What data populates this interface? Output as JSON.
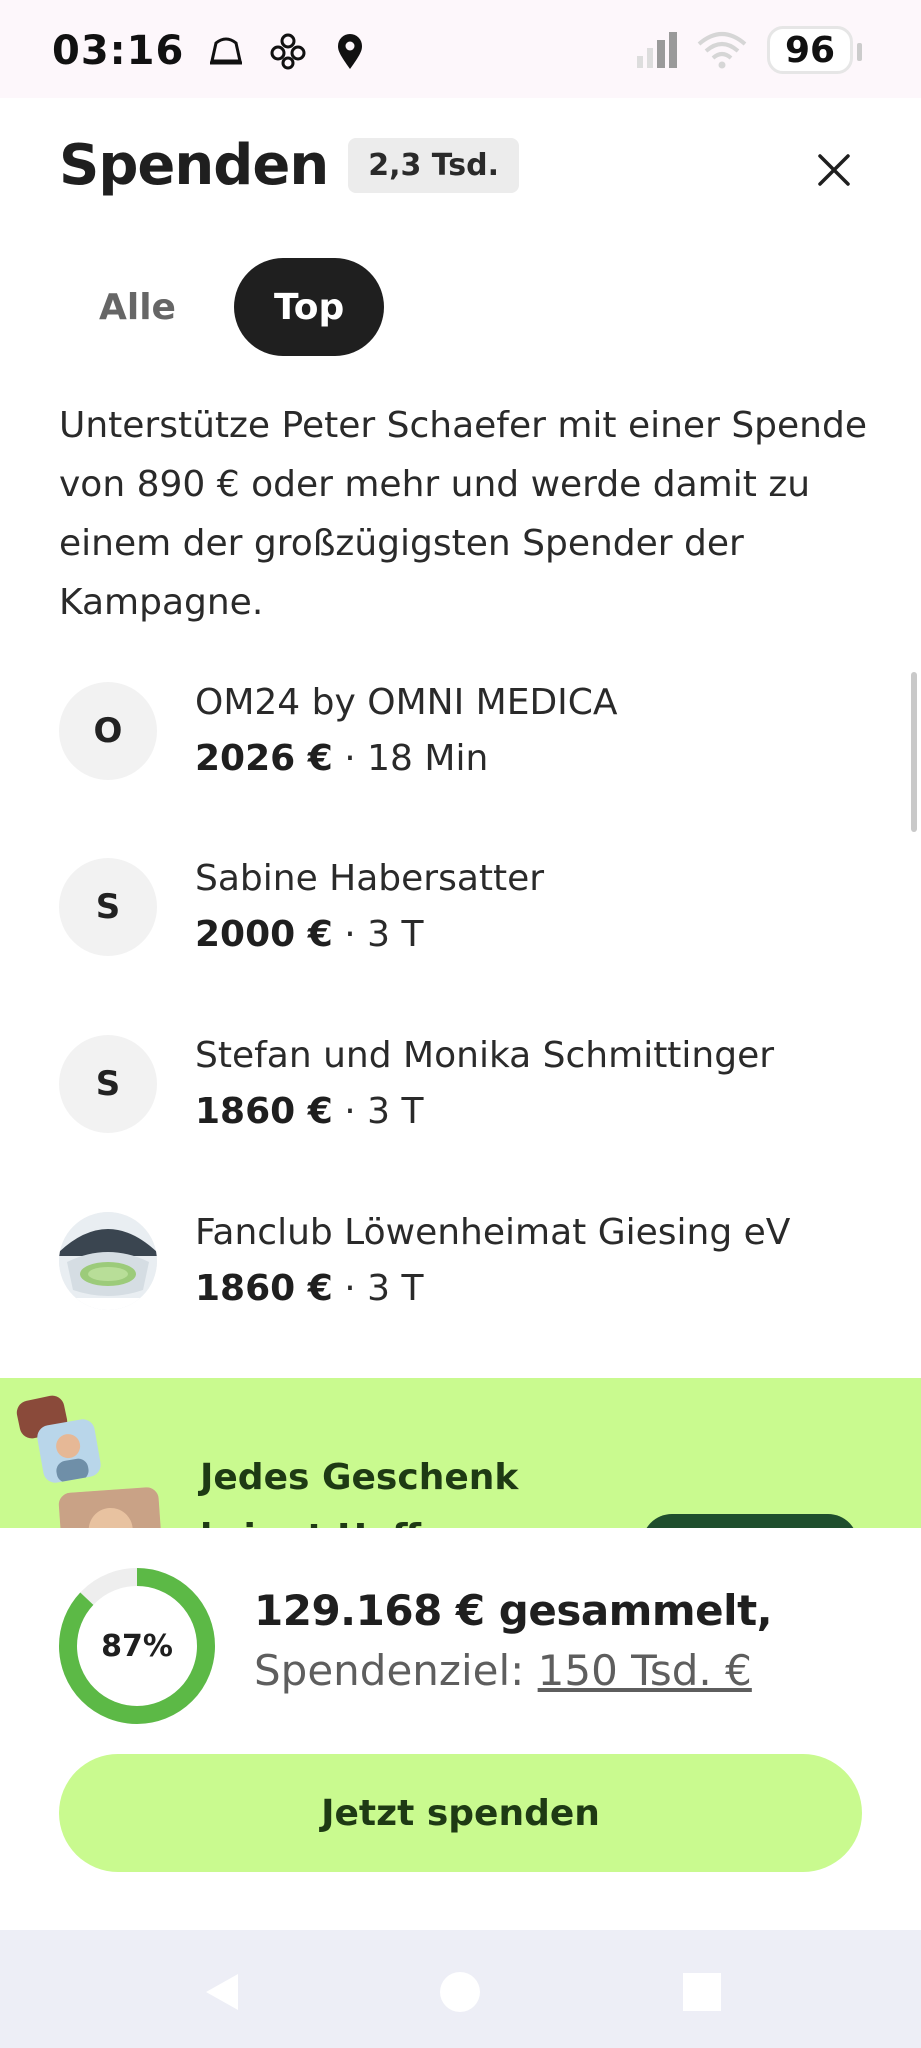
{
  "status_bar": {
    "clock": "03:16",
    "battery": "96",
    "icons": [
      "notification-icon",
      "flower-icon",
      "location-icon",
      "signal-icon",
      "wifi-icon"
    ]
  },
  "header": {
    "title": "Spenden",
    "count_badge": "2,3 Tsd."
  },
  "tabs": [
    {
      "label": "Alle",
      "active": false
    },
    {
      "label": "Top",
      "active": true
    }
  ],
  "description": "Unterstütze Peter Schaefer mit einer Spende von 890 € oder mehr und werde damit zu einem der großzügigsten Spender der Kampagne.",
  "donors": [
    {
      "initial": "O",
      "name": "OM24 by OMNI MEDICA",
      "amount": "2026 €",
      "time": "18 Min",
      "photo": false
    },
    {
      "initial": "S",
      "name": "Sabine Habersatter",
      "amount": "2000 €",
      "time": "3 T",
      "photo": false
    },
    {
      "initial": "S",
      "name": "Stefan und Monika Schmittinger",
      "amount": "1860 €",
      "time": "3 T",
      "photo": false
    },
    {
      "initial": "",
      "name": "Fanclub Löwenheimat Giesing eV",
      "amount": "1860 €",
      "time": "3 T",
      "photo": true
    }
  ],
  "separator": "·",
  "promo": {
    "heading": "Jedes Geschenk bringt Hoffnung"
  },
  "progress": {
    "percent_label": "87%",
    "percent_value": 0.87,
    "raised": "129.168 € gesammelt,",
    "goal_prefix": "Spendenziel:",
    "goal_value": "150 Tsd. €"
  },
  "donate_button": "Jetzt spenden",
  "colors": {
    "accent_green": "#c9fa8f",
    "ring_green": "#5cb946",
    "dark": "#1f1f1f"
  }
}
